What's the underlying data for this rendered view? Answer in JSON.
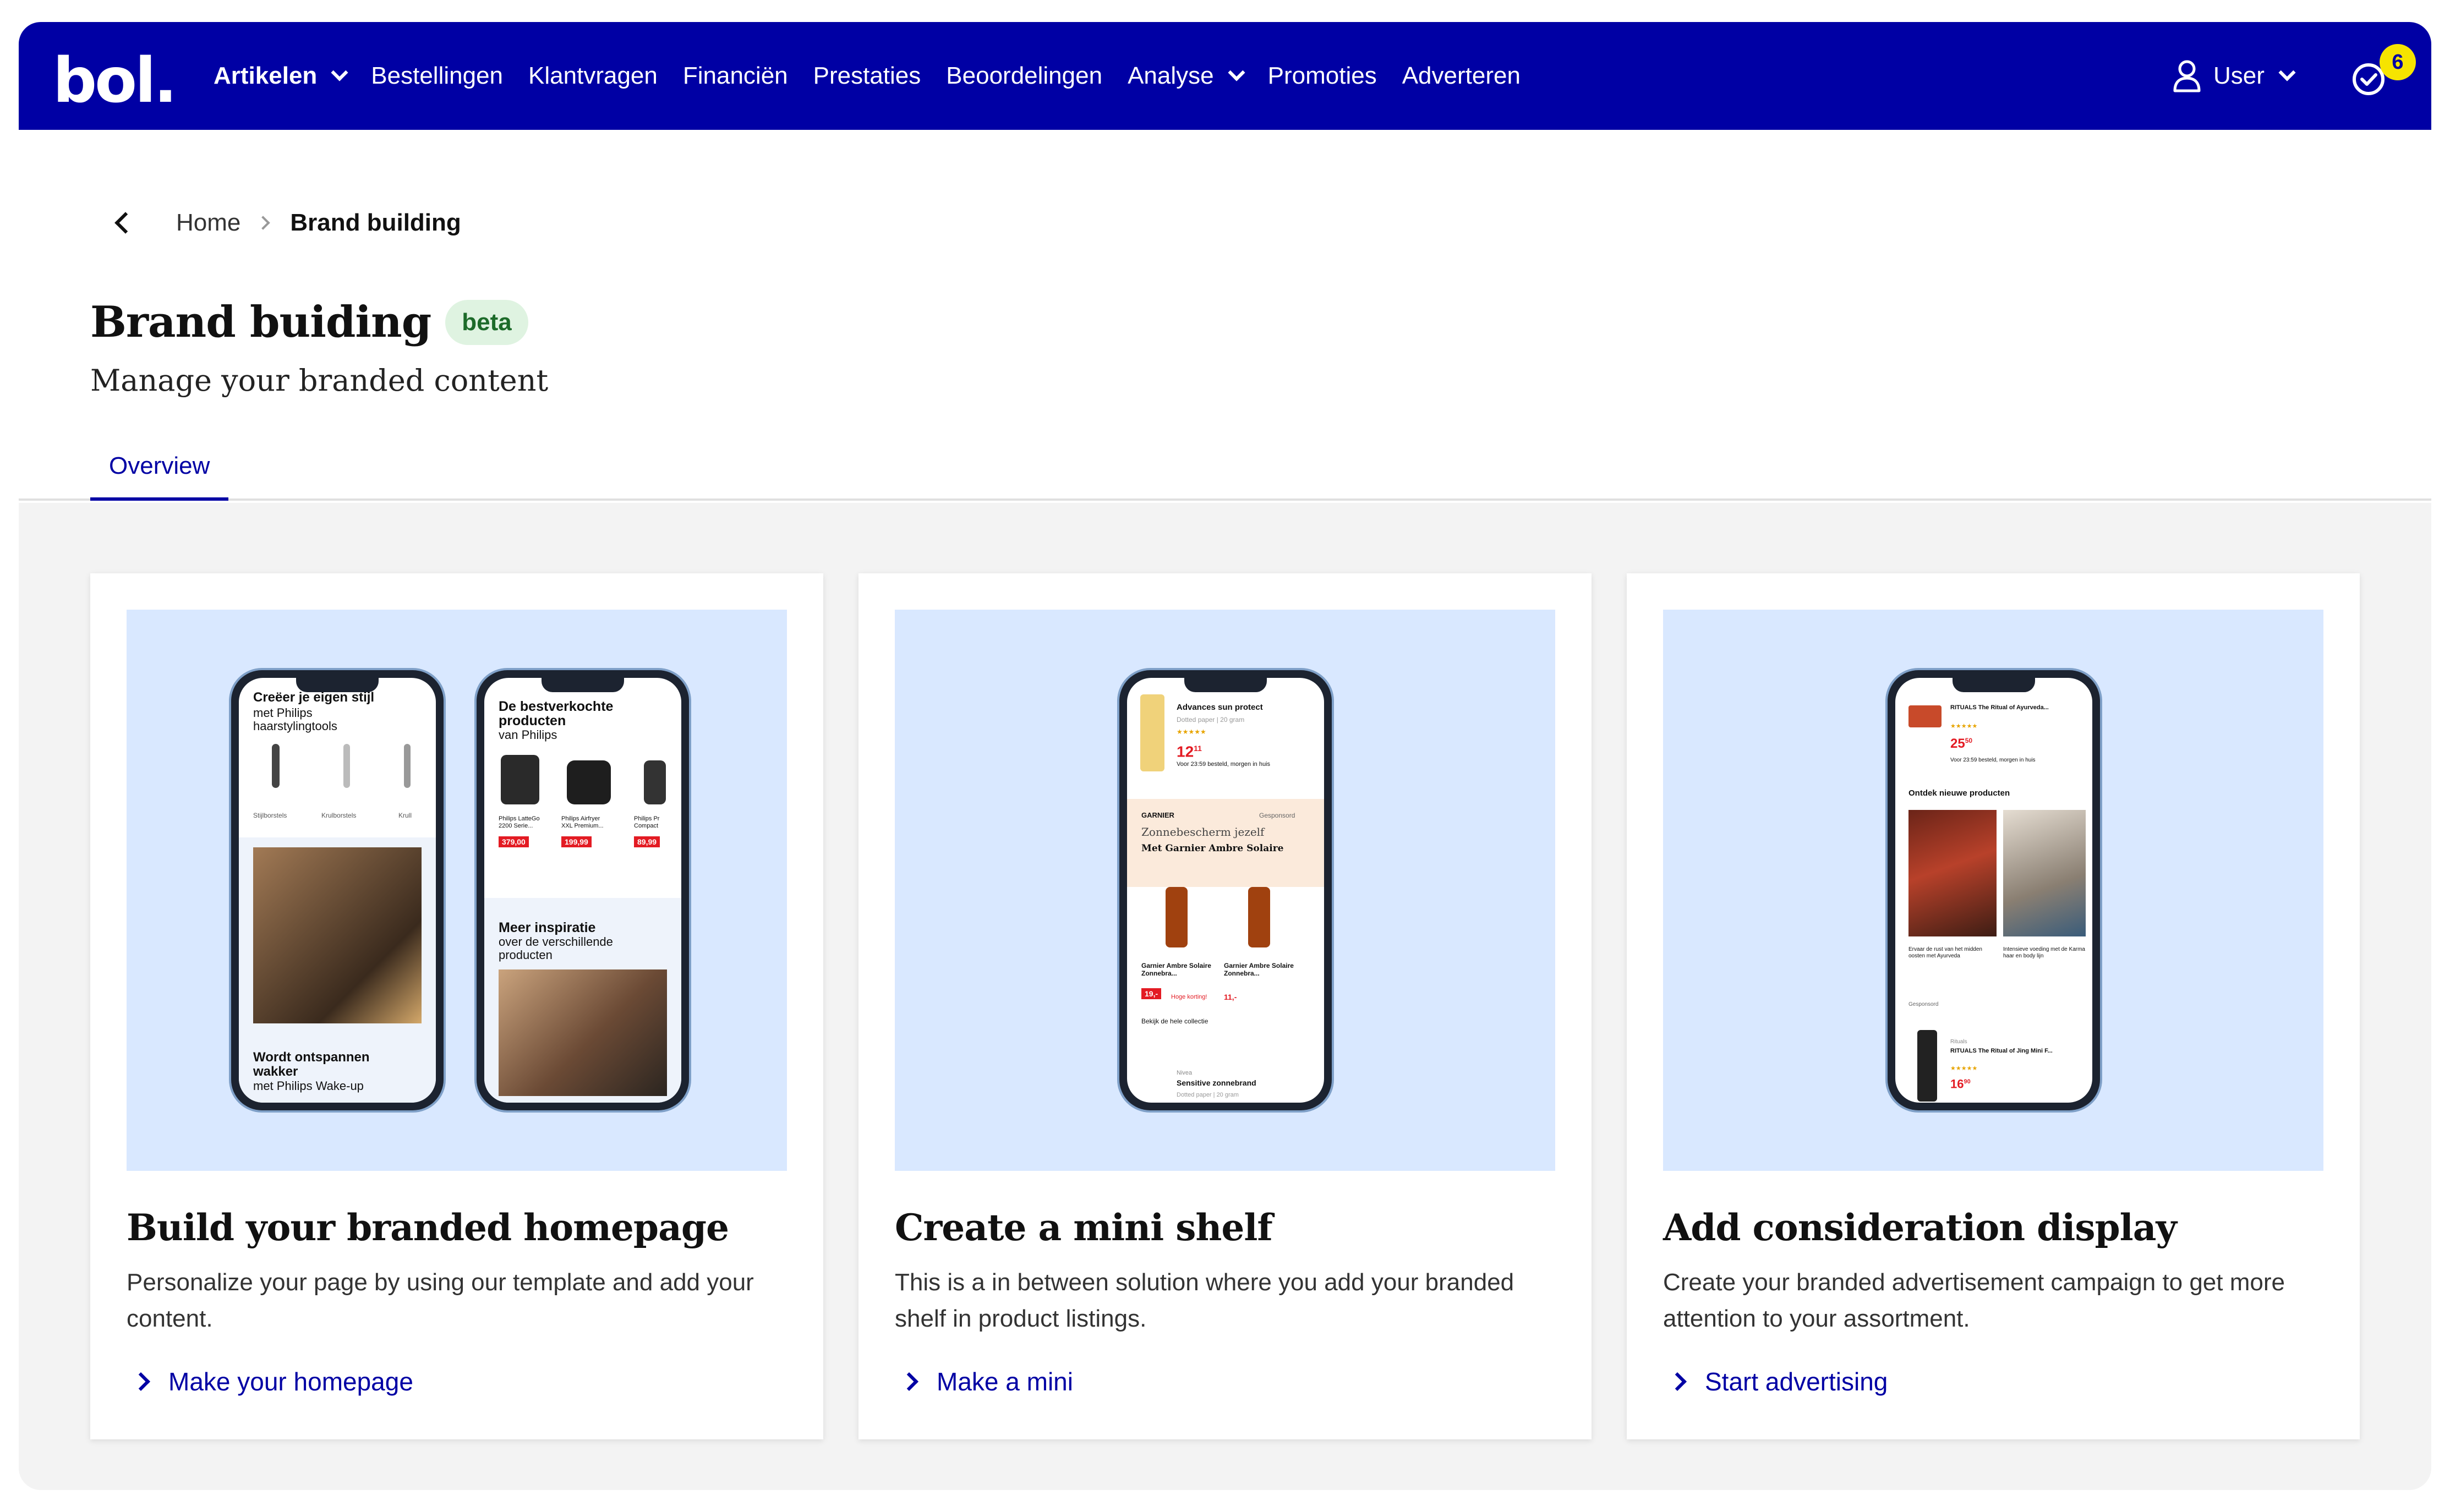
{
  "nav": {
    "logo": "bol.",
    "items": [
      {
        "label": "Artikelen",
        "dropdown": true,
        "bold": true
      },
      {
        "label": "Bestellingen",
        "dropdown": false
      },
      {
        "label": "Klantvragen",
        "dropdown": false
      },
      {
        "label": "Financiën",
        "dropdown": false
      },
      {
        "label": "Prestaties",
        "dropdown": false
      },
      {
        "label": "Beoordelingen",
        "dropdown": false
      },
      {
        "label": "Analyse",
        "dropdown": true
      },
      {
        "label": "Promoties",
        "dropdown": false
      },
      {
        "label": "Adverteren",
        "dropdown": false
      }
    ],
    "user_label": "User",
    "notification_count": "6",
    "brand_color": "#0000a4",
    "badge_color": "#f6e400"
  },
  "breadcrumb": {
    "home": "Home",
    "current": "Brand building"
  },
  "page": {
    "title": "Brand buiding",
    "badge": "beta",
    "subtitle": "Manage your branded content"
  },
  "tabs": [
    {
      "label": "Overview",
      "active": true
    }
  ],
  "cards": [
    {
      "title": "Build your branded homepage",
      "description": "Personalize your page by using our template and add your content.",
      "link": "Make your homepage",
      "phone1": {
        "heading": "Creëer je eigen stijl",
        "sub1": "met Philips",
        "sub2": "haarstylingtools",
        "labels": [
          "Stijlborstels",
          "Krulborstels",
          "Krull"
        ],
        "promo1": "Wordt ontspannen",
        "promo2": "wakker",
        "promo3": "met Philips Wake-up"
      },
      "phone2": {
        "heading1": "De bestverkochte",
        "heading2": "producten",
        "heading3": "van Philips",
        "products": [
          "Philips LatteGo 2200 Serie...",
          "Philips Airfryer XXL Premium...",
          "Philips Pr Compact"
        ],
        "prices": [
          "379,00",
          "199,99",
          "89,99"
        ],
        "inspire1": "Meer inspiratie",
        "inspire2": "over de verschillende",
        "inspire3": "producten"
      }
    },
    {
      "title": "Create a mini shelf",
      "description": "This is a in between solution where you add your branded shelf in product listings.",
      "link": "Make a mini",
      "phone": {
        "top_product": "Advances sun protect",
        "top_meta": "Dotted paper | 20 gram",
        "top_price": "12",
        "top_price_cents": "11",
        "top_delivery": "Voor 23:59 besteld, morgen in huis",
        "brand": "GARNIER",
        "sponsored": "Gesponsord",
        "shelf_title": "Zonnebescherm jezelf",
        "shelf_sub": "Met Garnier Ambre Solaire",
        "items": [
          "Garnier Ambre Solaire Zonnebra...",
          "Garnier Ambre Solaire Zonnebra..."
        ],
        "item_prices": [
          "19,-",
          "11,-"
        ],
        "discount": "Hoge korting!",
        "collection_link": "Bekijk de hele collectie",
        "bottom_brand": "Nivea",
        "bottom_product": "Sensitive zonnebrand",
        "bottom_meta": "Dotted paper | 20 gram"
      }
    },
    {
      "title": "Add consideration display",
      "description": "Create your branded advertisement campaign to get more attention to your assortment.",
      "link": "Start advertising",
      "phone": {
        "top_product": "RITUALS The Ritual of Ayurveda...",
        "top_price": "25",
        "top_price_cents": "50",
        "top_delivery": "Voor 23:59 besteld, morgen in huis",
        "section": "Ontdek nieuwe producten",
        "tile1": "Ervaar de rust van het midden oosten met Ayurveda",
        "tile2": "Intensieve voeding met de Karma haar en body lijn",
        "sponsored": "Gesponsord",
        "bottom_brand": "Rituals",
        "bottom_product": "RITUALS The Ritual of Jing Mini F...",
        "bottom_price": "16",
        "bottom_price_cents": "90"
      }
    }
  ]
}
